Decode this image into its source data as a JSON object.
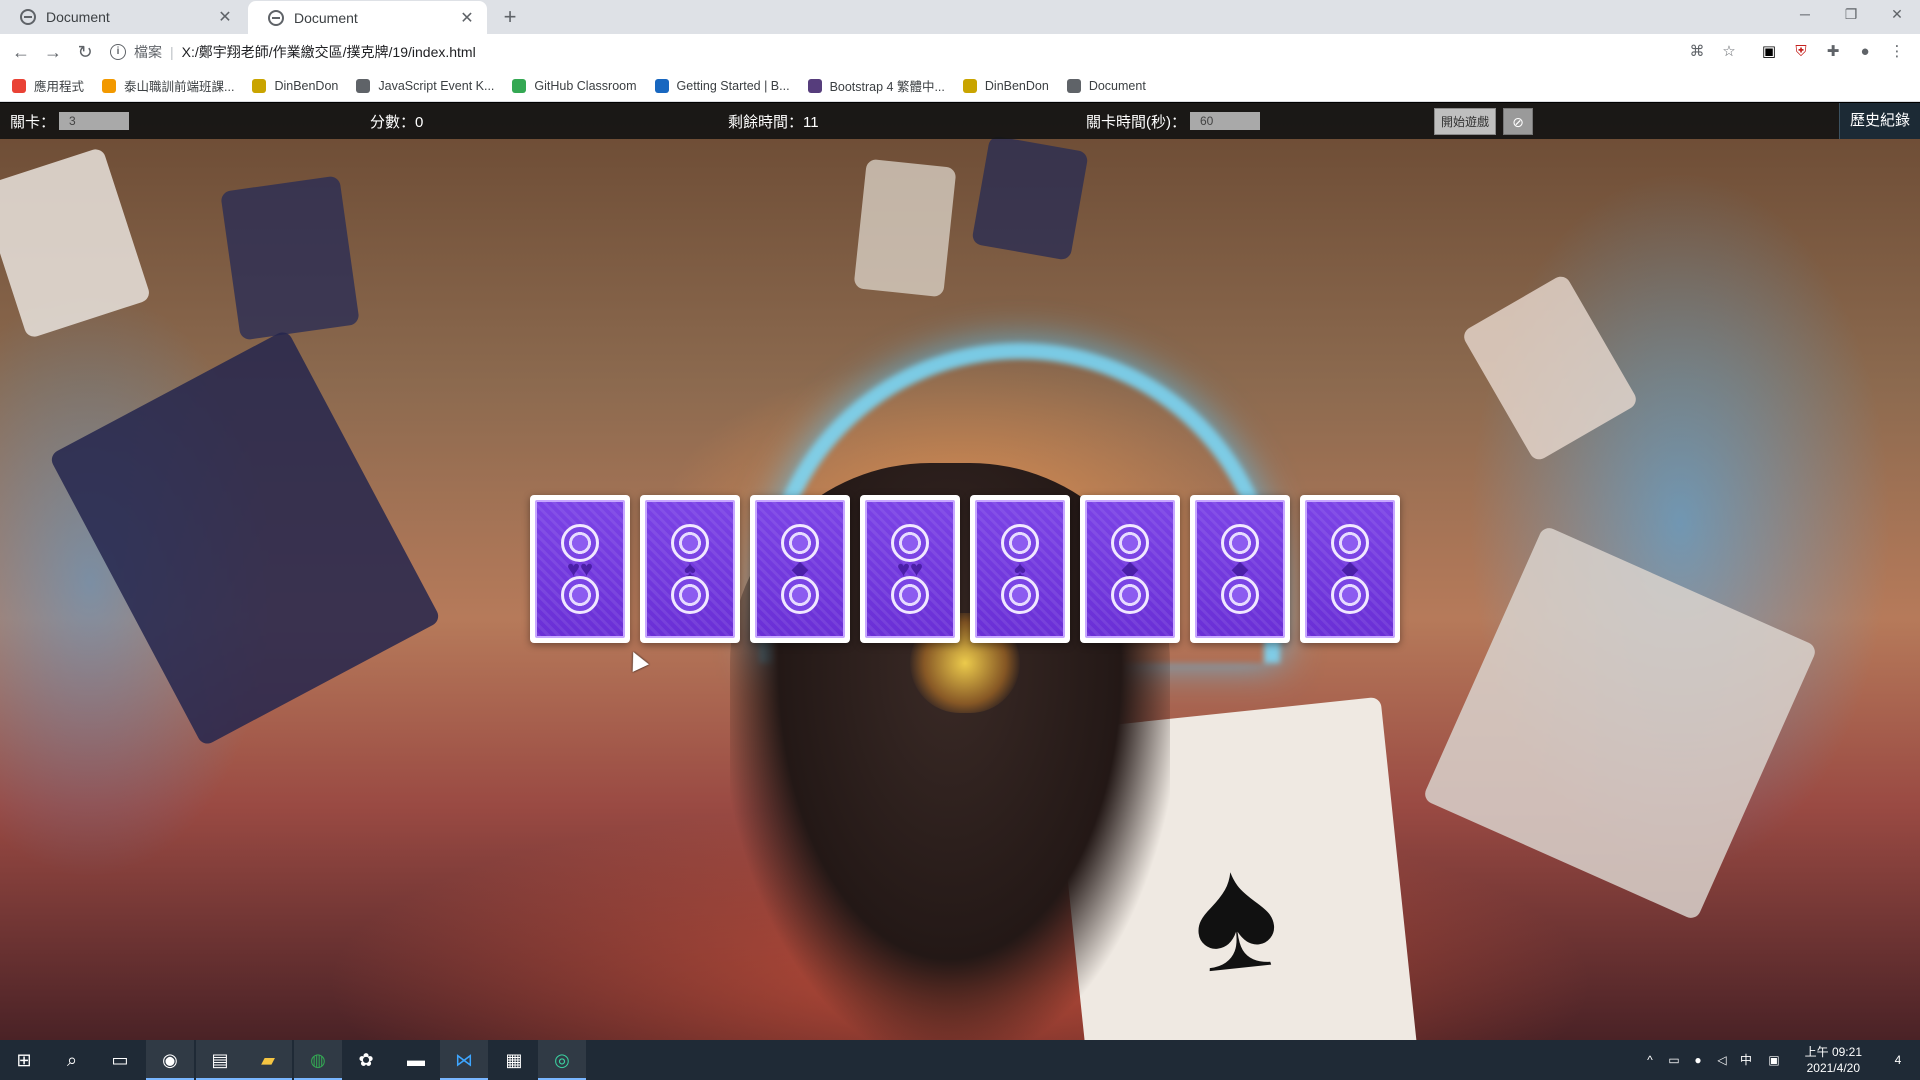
{
  "browser": {
    "tabs": [
      {
        "title": "Document",
        "active": false
      },
      {
        "title": "Document",
        "active": true
      }
    ],
    "new_tab_symbol": "+",
    "window_controls": {
      "minimize": "─",
      "restore": "❐",
      "close": "✕"
    },
    "address": {
      "scheme_label": "檔案",
      "url": "X:/鄭宇翔老師/作業繳交區/撲克牌/19/index.html"
    },
    "bookmarks": [
      {
        "label": "應用程式",
        "icon": "apps-grid-icon",
        "color": "#e94235"
      },
      {
        "label": "泰山職訓前端班課...",
        "icon": "pencil-icon",
        "color": "#f29900"
      },
      {
        "label": "DinBenDon",
        "icon": "bento-icon",
        "color": "#c9a400"
      },
      {
        "label": "JavaScript Event K...",
        "icon": "keyboard-icon",
        "color": "#5f6368"
      },
      {
        "label": "GitHub Classroom",
        "icon": "github-icon",
        "color": "#34a853"
      },
      {
        "label": "Getting Started | B...",
        "icon": "vuetify-icon",
        "color": "#1867c0"
      },
      {
        "label": "Bootstrap 4 繁體中...",
        "icon": "bootstrap-icon",
        "color": "#563d7c"
      },
      {
        "label": "DinBenDon",
        "icon": "bento-icon",
        "color": "#c9a400"
      },
      {
        "label": "Document",
        "icon": "globe-icon",
        "color": "#5f6368"
      }
    ]
  },
  "game": {
    "level_label": "關卡：",
    "level_value": "3",
    "score_text": "分數：0",
    "time_left_text": "剩餘時間：11",
    "level_time_label": "關卡時間(秒)：",
    "level_time_value": "60",
    "start_button": "開始遊戲",
    "history_button": "歷史紀錄",
    "cards": [
      {
        "mid": "♥♥"
      },
      {
        "mid": "♠"
      },
      {
        "mid": "◆"
      },
      {
        "mid": "♥♥"
      },
      {
        "mid": "♠"
      },
      {
        "mid": "◆"
      },
      {
        "mid": "◆"
      },
      {
        "mid": "◆"
      }
    ]
  },
  "taskbar": {
    "clock_period_time": "上午 09:21",
    "date": "2021/4/20",
    "ime": "中",
    "notification_count": "4"
  },
  "colors": {
    "card_back": "#6a2fd6",
    "gamebar_bg": "#141414",
    "taskbar_bg": "#1f2a36"
  }
}
